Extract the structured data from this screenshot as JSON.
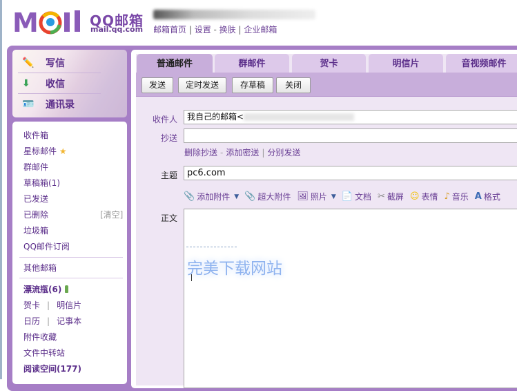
{
  "header": {
    "logo_text": "MOil",
    "brand": "QQ邮箱",
    "domain": "mail.qq.com",
    "links": [
      "邮箱首页",
      "设置",
      "换肤",
      "企业邮箱"
    ]
  },
  "quick": {
    "compose": "写信",
    "inbox": "收信",
    "contacts": "通讯录"
  },
  "nav": {
    "items": [
      "收件箱",
      "星标邮件",
      "群邮件",
      "草稿箱(1)",
      "已发送",
      "已删除",
      "垃圾箱",
      "QQ邮件订阅",
      "其他邮箱",
      "漂流瓶(6)",
      "贺卡",
      "明信片",
      "日历",
      "记事本",
      "附件收藏",
      "文件中转站",
      "阅读空间(177)"
    ],
    "clear": "[清空]",
    "divider": "|"
  },
  "tabs": [
    "普通邮件",
    "群邮件",
    "贺卡",
    "明信片",
    "音视频邮件"
  ],
  "toolbar": {
    "send": "发送",
    "timed_send": "定时发送",
    "save_draft": "存草稿",
    "close": "关闭"
  },
  "form": {
    "to_label": "收件人",
    "to_value": "我自己的邮箱<",
    "cc_label": "抄送",
    "cc_value": "",
    "links": [
      "删除抄送",
      "添加密送",
      "分别发送"
    ],
    "subject_label": "主题",
    "subject_value": "pc6.com",
    "body_label": "正文"
  },
  "attach_tools": [
    "添加附件",
    "超大附件",
    "照片",
    "文档",
    "截屏",
    "表情",
    "音乐",
    "格式"
  ],
  "body": {
    "watermark": "完美下载网站"
  },
  "colors": {
    "accent": "#a67ec6",
    "text": "#5b2e8a",
    "panel": "#efe6f4"
  }
}
